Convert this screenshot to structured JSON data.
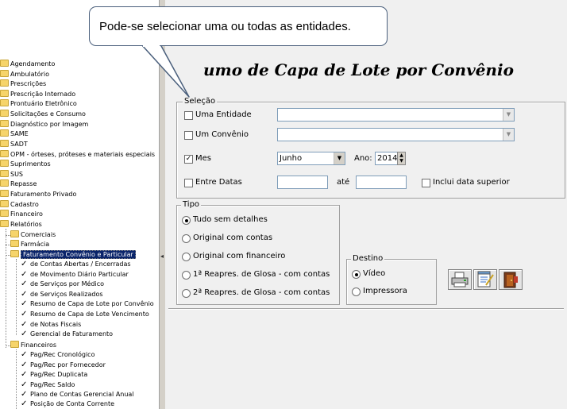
{
  "tree": {
    "items": [
      {
        "label": "Agendamento",
        "icon": "folder-icon"
      },
      {
        "label": "Ambulatório",
        "icon": "folder-icon"
      },
      {
        "label": "Prescrições",
        "icon": "folder-icon"
      },
      {
        "label": "Prescrição Internado",
        "icon": "folder-icon"
      },
      {
        "label": "Prontuário Eletrônico",
        "icon": "folder-icon"
      },
      {
        "label": "Solicitações e Consumo",
        "icon": "folder-icon"
      },
      {
        "label": "Diagnóstico por Imagem",
        "icon": "folder-icon"
      },
      {
        "label": "SAME",
        "icon": "folder-icon"
      },
      {
        "label": "SADT",
        "icon": "folder-icon"
      },
      {
        "label": "OPM - órteses, próteses e materiais especiais",
        "icon": "folder-icon"
      },
      {
        "label": "Suprimentos",
        "icon": "folder-icon"
      },
      {
        "label": "SUS",
        "icon": "folder-icon"
      },
      {
        "label": "Repasse",
        "icon": "folder-icon"
      },
      {
        "label": "Faturamento Privado",
        "icon": "folder-icon"
      },
      {
        "label": "Cadastro",
        "icon": "folder-icon"
      },
      {
        "label": "Financeiro",
        "icon": "folder-icon"
      },
      {
        "label": "Relatórios",
        "icon": "folder-icon"
      }
    ],
    "relatorios_children": [
      {
        "label": "Comerciais",
        "icon": "folder-icon"
      },
      {
        "label": "Farmácia",
        "icon": "folder-icon"
      },
      {
        "label": "Faturamento Convênio e Particular",
        "icon": "folder-icon"
      }
    ],
    "faturamento_children": [
      {
        "label": "de Contas Abertas / Encerradas"
      },
      {
        "label": "de Movimento Diário Particular"
      },
      {
        "label": "de Serviços por Médico"
      },
      {
        "label": "de Serviços Realizados"
      },
      {
        "label": "Resumo de Capa de Lote por Convênio"
      },
      {
        "label": "Resumo de Capa de Lote Vencimento"
      },
      {
        "label": "de Notas Fiscais"
      },
      {
        "label": "Gerencial de Faturamento"
      }
    ],
    "financeiros_label": "Financeiros",
    "financeiros_children": [
      {
        "label": "Pag/Rec Cronológico"
      },
      {
        "label": "Pag/Rec por Fornecedor"
      },
      {
        "label": "Pag/Rec Duplicata"
      },
      {
        "label": "Pag/Rec Saldo"
      },
      {
        "label": "Plano de Contas Gerencial Anual"
      },
      {
        "label": "Posição de Conta Corrente"
      }
    ]
  },
  "callout": {
    "text": "Pode-se selecionar uma ou todas as entidades."
  },
  "form": {
    "title": "umo de Capa de Lote por Convênio",
    "selecao": {
      "legend": "Seleção",
      "uma_entidade": "Uma Entidade",
      "um_convenio": "Um Convênio",
      "mes": "Mes",
      "mes_checked": true,
      "mes_value": "Junho",
      "ano_label": "Ano:",
      "ano_value": "2014",
      "entre_datas": "Entre Datas",
      "ate": "até",
      "inclui": "Inclui data superior"
    },
    "tipo": {
      "legend": "Tipo",
      "options": [
        "Tudo sem detalhes",
        "Original com contas",
        "Original com financeiro",
        "1ª Reapres. de Glosa - com contas",
        "2ª Reapres. de Glosa - com contas"
      ],
      "selected": 0
    },
    "destino": {
      "legend": "Destino",
      "video": "Vídeo",
      "impressora": "Impressora",
      "selected": "Vídeo"
    },
    "buttons": [
      {
        "name": "print-button",
        "icon": "printer-icon"
      },
      {
        "name": "preview-button",
        "icon": "notepad-icon"
      },
      {
        "name": "exit-button",
        "icon": "door-exit-icon"
      }
    ]
  }
}
